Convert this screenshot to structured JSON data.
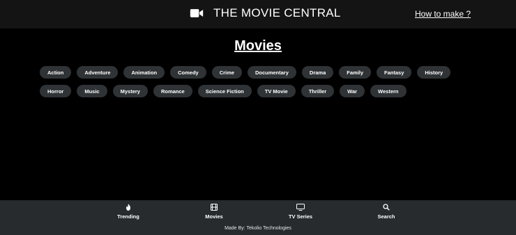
{
  "header": {
    "title": "THE MOVIE CENTRAL",
    "how_to_link": "How to make ?",
    "brand_icon": "video-camera-icon"
  },
  "main": {
    "title": "Movies",
    "genres": [
      "Action",
      "Adventure",
      "Animation",
      "Comedy",
      "Crime",
      "Documentary",
      "Drama",
      "Family",
      "Fantasy",
      "History",
      "Horror",
      "Music",
      "Mystery",
      "Romance",
      "Science Fiction",
      "TV Movie",
      "Thriller",
      "War",
      "Western"
    ]
  },
  "bottom_nav": {
    "items": [
      {
        "label": "Trending",
        "icon": "flame-icon"
      },
      {
        "label": "Movies",
        "icon": "film-icon"
      },
      {
        "label": "TV Series",
        "icon": "tv-icon"
      },
      {
        "label": "Search",
        "icon": "search-icon"
      }
    ],
    "credit": "Made By: Tekolio Technologies"
  },
  "colors": {
    "background": "#000000",
    "header": "#141414",
    "chip": "#2f3336",
    "bottom_nav": "#272b2e",
    "text": "#ffffff"
  }
}
